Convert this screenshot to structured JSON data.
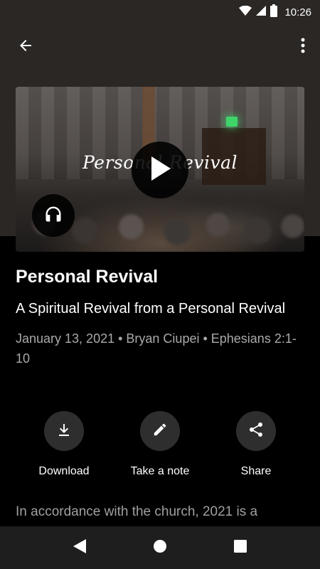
{
  "status_bar": {
    "time": "10:26",
    "icons": [
      "wifi-icon",
      "cell-signal-icon",
      "battery-icon"
    ]
  },
  "app_bar": {
    "back_icon": "arrow-back-icon",
    "menu_icon": "more-vert-icon"
  },
  "media": {
    "thumbnail_title": "Personal Revival",
    "play_icon": "play-icon",
    "audio_icon": "headphones-icon"
  },
  "sermon": {
    "title": "Personal Revival",
    "subtitle": "A Spiritual Revival from a Personal Revival",
    "meta": "January 13, 2021 • Bryan Ciupei • Ephesians 2:1-10"
  },
  "actions": [
    {
      "label": "Download",
      "icon": "download-icon"
    },
    {
      "label": "Take a note",
      "icon": "pencil-icon"
    },
    {
      "label": "Share",
      "icon": "share-icon"
    }
  ],
  "description": "In accordance with the church, 2021 is a",
  "colors": {
    "header_bg": "#2b2725",
    "background": "#000000",
    "action_circle": "#2e2e2e",
    "meta_text": "#a9a9a9",
    "nav_bar": "#1e1e1e"
  }
}
